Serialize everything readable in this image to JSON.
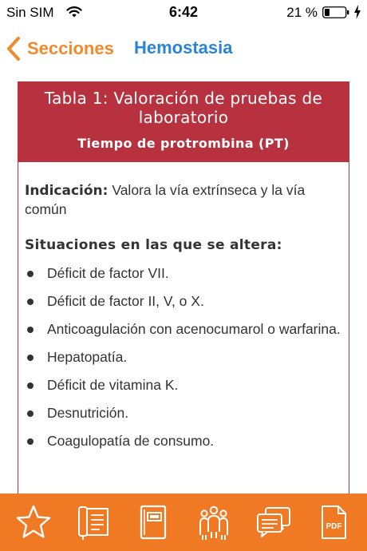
{
  "status_bar": {
    "carrier": "Sin SIM",
    "time": "6:42",
    "battery_percent": "21 %",
    "icons": [
      "wifi-icon",
      "battery-icon",
      "charging-bolt-icon"
    ]
  },
  "nav": {
    "back_label": "Secciones",
    "title": "Hemostasia",
    "back_color": "#f08a2c",
    "title_color": "#2a86d4"
  },
  "card": {
    "title": "Tabla 1: Valoración de pruebas de laboratorio",
    "subtitle": "Tiempo de protrombina (PT)",
    "header_color": "#b7323e",
    "indication_label": "Indicación:",
    "indication_text": " Valora la vía extrínseca y la vía común",
    "alterations_heading": "Situaciones en las que se altera:",
    "alterations": [
      "Déficit de factor VII.",
      "Déficit de factor II, V, o X.",
      "Anticoagulación con acenocumarol o warfarina.",
      "Hepatopatía.",
      "Déficit de vitamina K.",
      "Desnutrición.",
      "Coagulopatía de consumo."
    ]
  },
  "tab_bar": {
    "color": "#f07a23",
    "items": [
      "star-icon",
      "notes-icon",
      "book-icon",
      "team-icon",
      "chat-icon",
      "pdf-icon"
    ],
    "pdf_label": "PDF"
  }
}
